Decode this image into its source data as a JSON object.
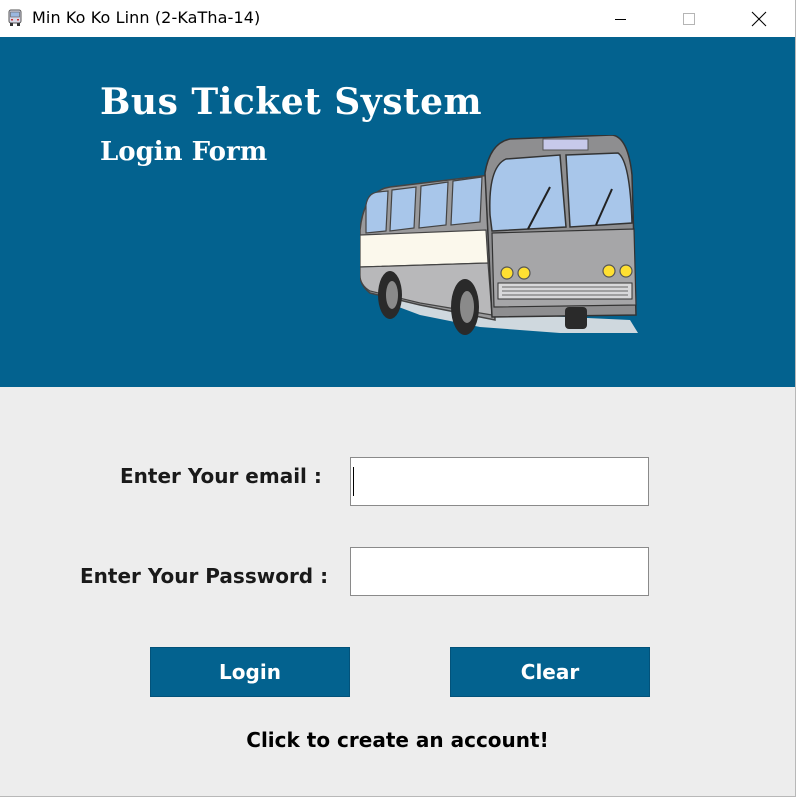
{
  "window": {
    "title": "Min Ko Ko Linn (2-KaTha-14)",
    "icon": "bus-app-icon",
    "controls": [
      "minimize-icon",
      "maximize-icon",
      "close-icon"
    ]
  },
  "banner": {
    "title": "Bus Ticket System",
    "subtitle": "Login Form",
    "image": "bus-illustration",
    "background_color": "#03628f"
  },
  "form": {
    "email_label": "Enter Your email :",
    "email_value": "",
    "password_label": "Enter Your Password :",
    "password_value": ""
  },
  "buttons": {
    "login_label": "Login",
    "clear_label": "Clear",
    "color": "#03628f"
  },
  "footer": {
    "create_account_link": "Click to create an account!"
  }
}
